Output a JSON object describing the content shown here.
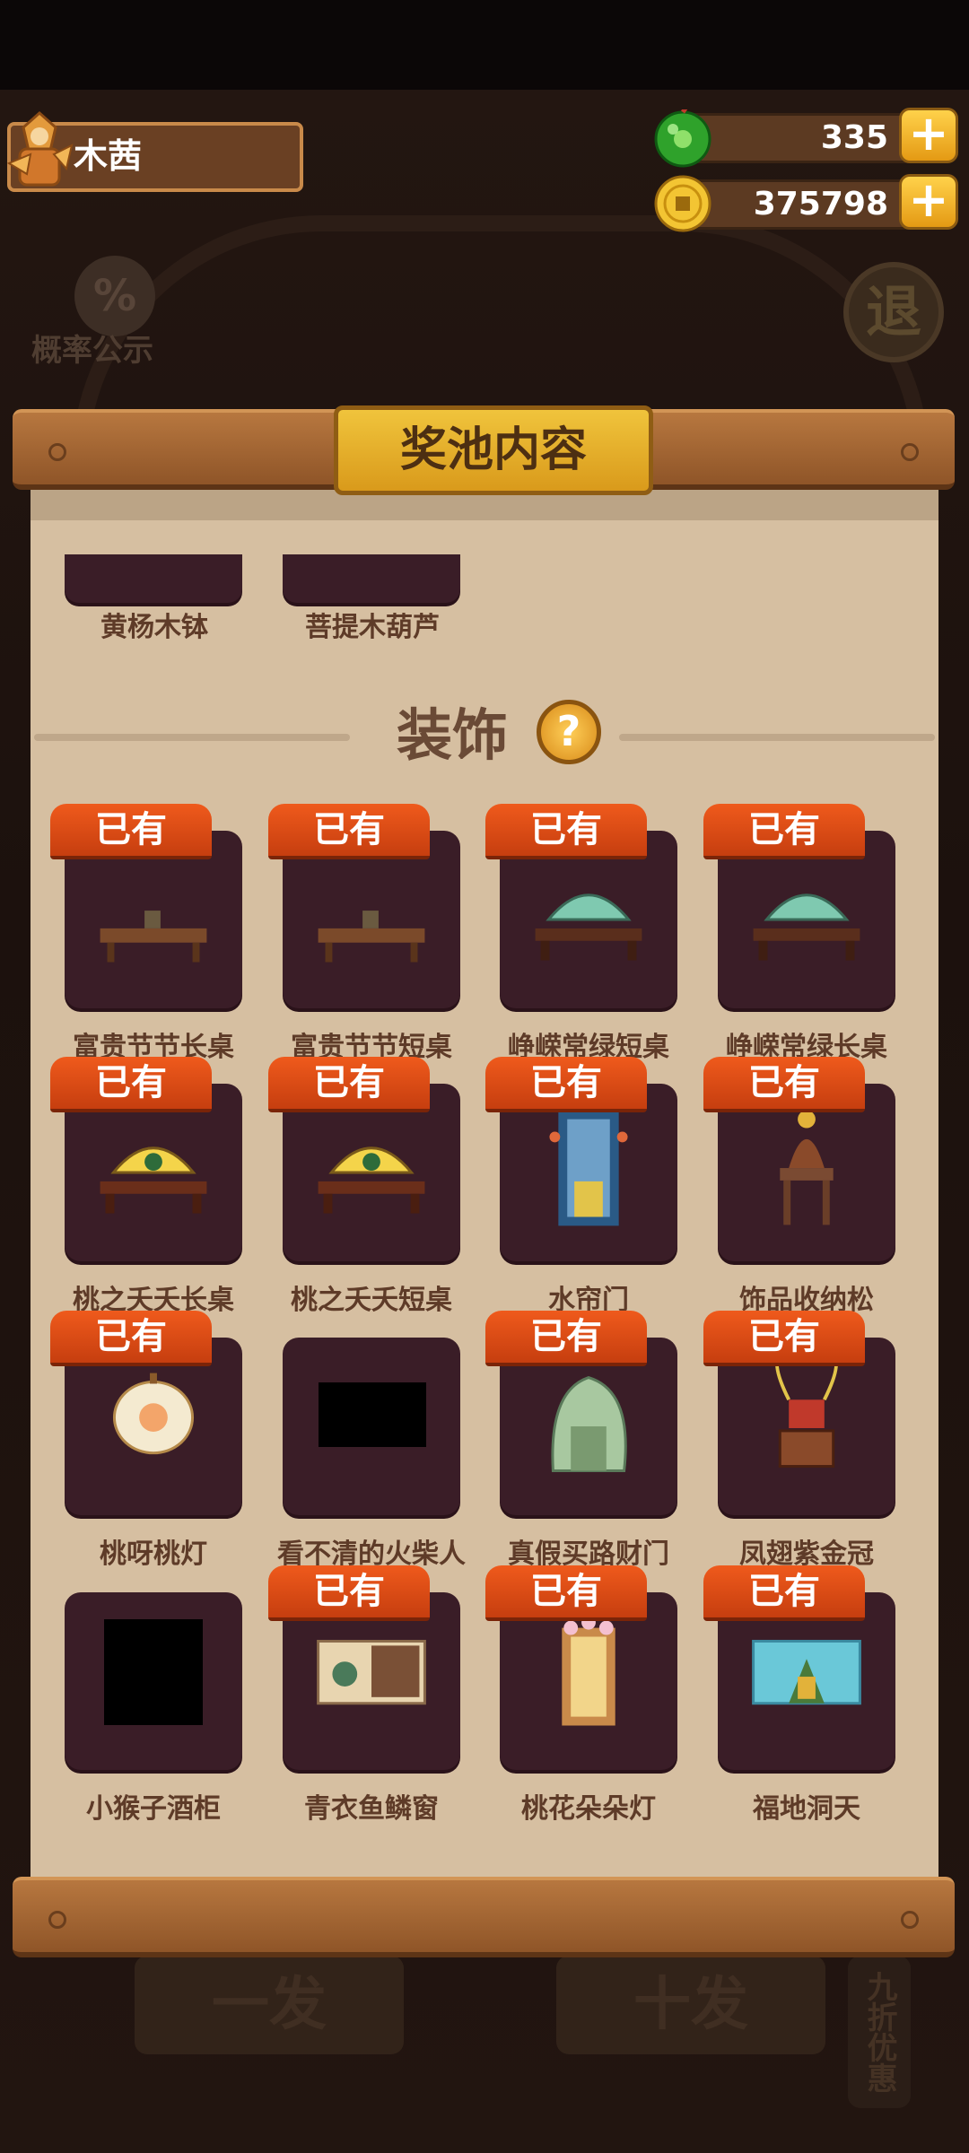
{
  "player": {
    "name": "木茜"
  },
  "currency": {
    "jade": {
      "value": "335",
      "plus": "+"
    },
    "coin": {
      "value": "375798",
      "plus": "+"
    }
  },
  "background": {
    "probability_label": "概率公示",
    "probability_symbol": "%",
    "exit_label": "退",
    "single_draw": "一发",
    "ten_draw": "十发",
    "discount_tag": "九折优惠"
  },
  "panel": {
    "title": "奖池内容"
  },
  "partial_items": [
    {
      "name": "黄杨木钵"
    },
    {
      "name": "菩提木葫芦"
    }
  ],
  "section": {
    "title": "装饰",
    "help": "?"
  },
  "owned_label": "已有",
  "items": [
    {
      "name": "富贵节节长桌",
      "owned": true
    },
    {
      "name": "富贵节节短桌",
      "owned": true
    },
    {
      "name": "峥嵘常绿短桌",
      "owned": true
    },
    {
      "name": "峥嵘常绿长桌",
      "owned": true
    },
    {
      "name": "桃之夭夭长桌",
      "owned": true
    },
    {
      "name": "桃之夭夭短桌",
      "owned": true
    },
    {
      "name": "水帘门",
      "owned": true
    },
    {
      "name": "饰品收纳松",
      "owned": true
    },
    {
      "name": "桃呀桃灯",
      "owned": true
    },
    {
      "name": "看不清的火柴人",
      "owned": false
    },
    {
      "name": "真假买路财门",
      "owned": true
    },
    {
      "name": "凤翅紫金冠",
      "owned": true
    },
    {
      "name": "小猴子酒柜",
      "owned": false
    },
    {
      "name": "青衣鱼鳞窗",
      "owned": true
    },
    {
      "name": "桃花朵朵灯",
      "owned": true
    },
    {
      "name": "福地洞天",
      "owned": true
    }
  ],
  "colors": {
    "accent": "#e4511a",
    "card": "#3a1d27",
    "paper": "#d6bfa1",
    "gold": "#e9b32c"
  }
}
